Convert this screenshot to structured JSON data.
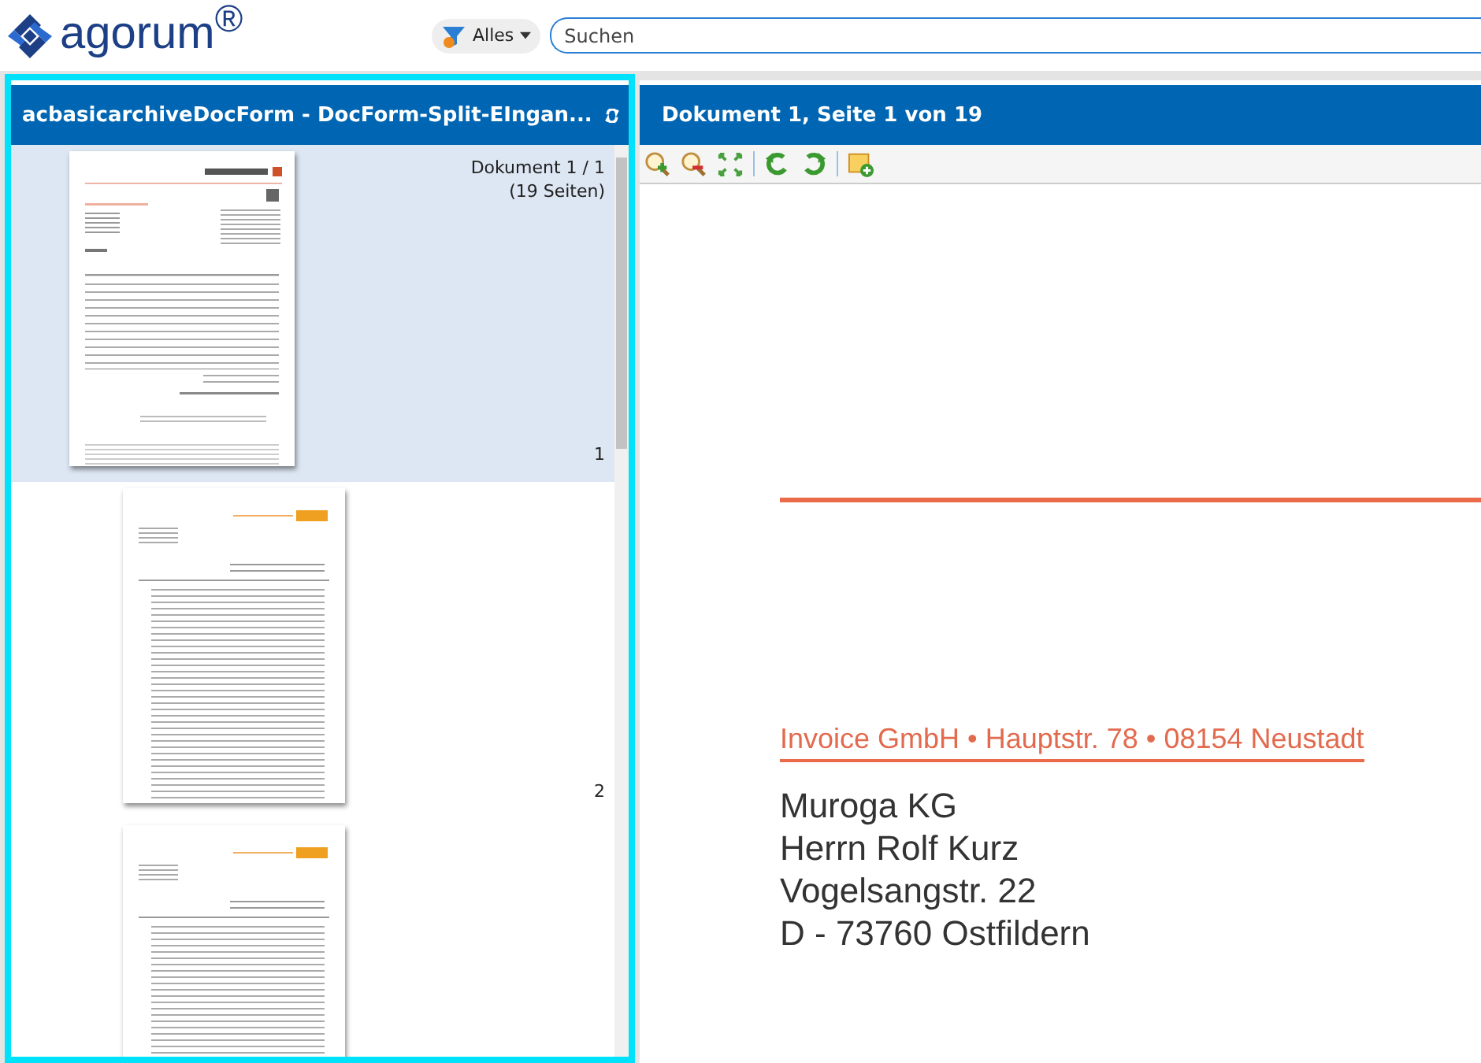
{
  "header": {
    "logo": "agorum$^{®}$",
    "filter": {
      "label": "Alles"
    },
    "search": {
      "placeholder": "Suchen"
    }
  },
  "left_panel": {
    "title": "acbasicarchiveDocForm - DocForm-Split-EIngan...",
    "focused": true,
    "pages": [
      {
        "selected": true,
        "kind": "invoice",
        "document_label": "Dokument 1 / 1",
        "page_count": "(19 Seiten)",
        "number": "1"
      },
      {
        "selected": false,
        "kind": "table",
        "number": "2"
      },
      {
        "selected": false,
        "kind": "table"
      }
    ]
  },
  "viewer": {
    "title": "Dokument 1, Seite 1 von 19",
    "document": {
      "sender_line": "Invoice GmbH • Hauptstr. 78 • 08154 Neustadt",
      "address": [
        "Muroga KG",
        "Herrn Rolf Kurz",
        "Vogelsangstr. 22",
        "D - 73760 Ostfildern"
      ]
    }
  }
}
